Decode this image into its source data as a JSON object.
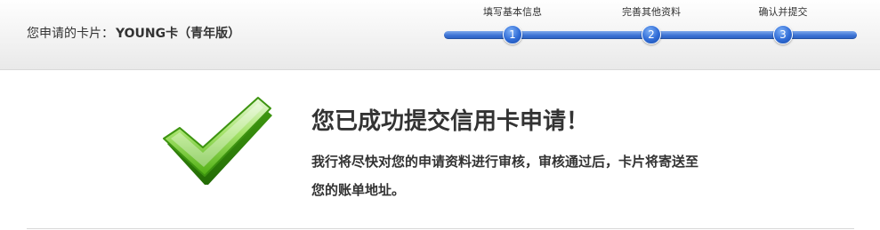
{
  "header": {
    "card_title_prefix": "您申请的卡片：",
    "card_name": "YOUNG卡（青年版）"
  },
  "steps": [
    {
      "label": "填写基本信息",
      "number": "1"
    },
    {
      "label": "完善其他资料",
      "number": "2"
    },
    {
      "label": "确认并提交",
      "number": "3"
    }
  ],
  "result": {
    "icon": "checkmark-icon",
    "title": "您已成功提交信用卡申请！",
    "message": "我行将尽快对您的申请资料进行审核，审核通过后，卡片将寄送至您的账单地址。"
  },
  "colors": {
    "step_blue": "#2f6bd6",
    "check_green": "#5bc21c",
    "text": "#333333"
  }
}
